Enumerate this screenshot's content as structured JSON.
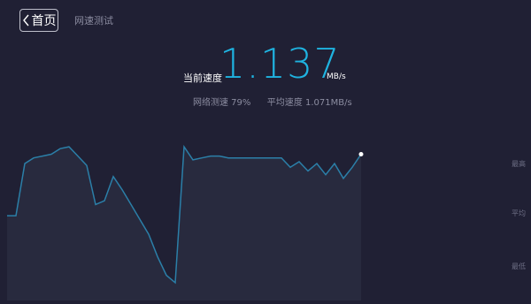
{
  "header": {
    "back_label": "首页",
    "title": "网速测试"
  },
  "speed": {
    "label": "当前速度",
    "value": "1.137",
    "unit": "MB/s"
  },
  "stats": {
    "progress_text": "网络测速 79%",
    "progress": 0.79,
    "avg_text": "平均速度 1.071MB/s"
  },
  "colors": {
    "background": "#202034",
    "accent": "#1fb3e0",
    "line": "#2b7fa8",
    "area": "#282a3e"
  },
  "chart_data": {
    "type": "area",
    "x": [
      0,
      1,
      2,
      3,
      4,
      5,
      6,
      7,
      8,
      9,
      10,
      11,
      12,
      13,
      14,
      15,
      16,
      17,
      18,
      19,
      20,
      21,
      22,
      23,
      24,
      25,
      26,
      27,
      28,
      29,
      30,
      31,
      32,
      33,
      34,
      35,
      36,
      37,
      38,
      39,
      40
    ],
    "values": [
      0.72,
      0.72,
      1.0,
      1.03,
      1.04,
      1.05,
      1.08,
      1.09,
      1.04,
      0.99,
      0.78,
      0.8,
      0.93,
      0.86,
      0.78,
      0.7,
      0.62,
      0.5,
      0.4,
      0.36,
      1.09,
      1.02,
      1.03,
      1.04,
      1.04,
      1.03,
      1.03,
      1.03,
      1.03,
      1.03,
      1.03,
      1.03,
      0.98,
      1.01,
      0.96,
      1.0,
      0.94,
      1.0,
      0.92,
      0.98,
      1.05
    ],
    "y_labels": [
      "最高",
      "平均",
      "最低"
    ],
    "grid": false,
    "legend": "none"
  }
}
